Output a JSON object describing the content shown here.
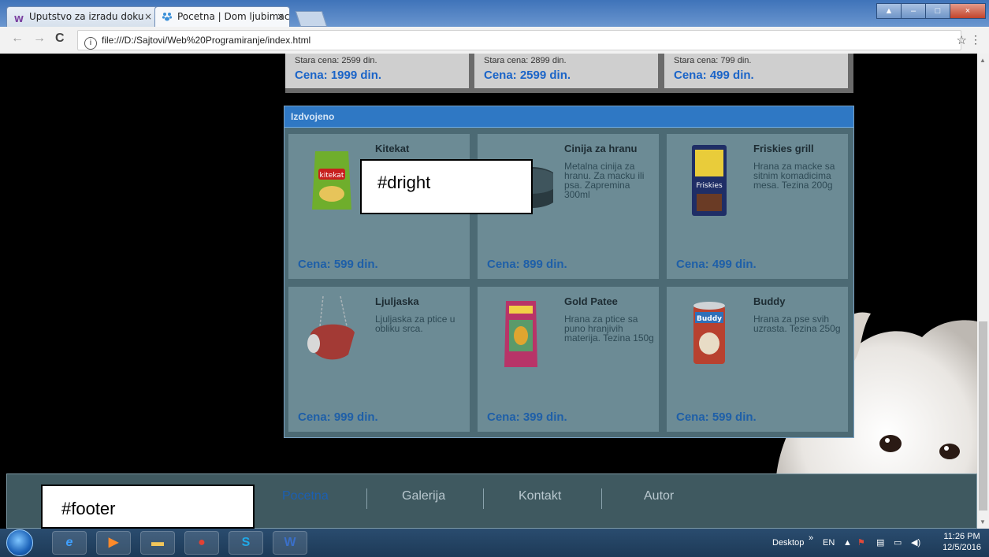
{
  "browser": {
    "tabs": [
      {
        "favicon": "W",
        "title": "Uputstvo za izradu doku",
        "close": "×"
      },
      {
        "favicon": "paw",
        "title": "Pocetna | Dom ljubimaca",
        "close": "×"
      }
    ],
    "address": "file:///D:/Sajtovi/Web%20Programiranje/index.html",
    "nav_back": "←",
    "nav_forward": "→",
    "nav_reload": "C",
    "info_icon": "i",
    "star": "☆",
    "menu": "⋮"
  },
  "top_prices": [
    {
      "old": "Stara cena: 2599 din.",
      "price": "Cena: 1999 din."
    },
    {
      "old": "Stara cena: 2899 din.",
      "price": "Cena: 2599 din."
    },
    {
      "old": "Stara cena: 799 din.",
      "price": "Cena: 499 din."
    }
  ],
  "featured": {
    "title": "Izdvojeno",
    "cards": [
      {
        "name": "Kitekat",
        "desc": "",
        "price": "Cena: 599 din."
      },
      {
        "name": "Cinija za hranu",
        "desc": "Metalna cinija za hranu. Za macku ili psa. Zapremina 300ml",
        "price": "Cena: 899 din."
      },
      {
        "name": "Friskies grill",
        "desc": "Hrana za macke sa sitnim komadicima mesa. Tezina 200g",
        "price": "Cena: 499 din."
      },
      {
        "name": "Ljuljaska",
        "desc": "Ljuljaska za ptice u obliku srca.",
        "price": "Cena: 999 din."
      },
      {
        "name": "Gold Patee",
        "desc": "Hrana za ptice sa puno hranjivih materija. Tezina 150g",
        "price": "Cena: 399 din."
      },
      {
        "name": "Buddy",
        "desc": "Hrana za pse svih uzrasta. Tezina 250g",
        "price": "Cena: 599 din."
      }
    ]
  },
  "annotations": {
    "dright": "#dright",
    "footer": "#footer"
  },
  "footer_nav": [
    {
      "label": "Pocetna",
      "active": true
    },
    {
      "label": "Galerija",
      "active": false
    },
    {
      "label": "Kontakt",
      "active": false
    },
    {
      "label": "Autor",
      "active": false
    }
  ],
  "colors": {
    "active_nav": "#1b5fb3",
    "nav": "#b9c8cf",
    "price": "#1e5fa8"
  },
  "taskbar": {
    "apps": [
      "ie-icon",
      "media-player-icon",
      "explorer-icon",
      "chrome-icon",
      "skype-icon",
      "word-icon"
    ],
    "desktop": "Desktop",
    "chevron": "»",
    "lang": "EN",
    "time": "11:26 PM",
    "date": "12/5/2016"
  }
}
